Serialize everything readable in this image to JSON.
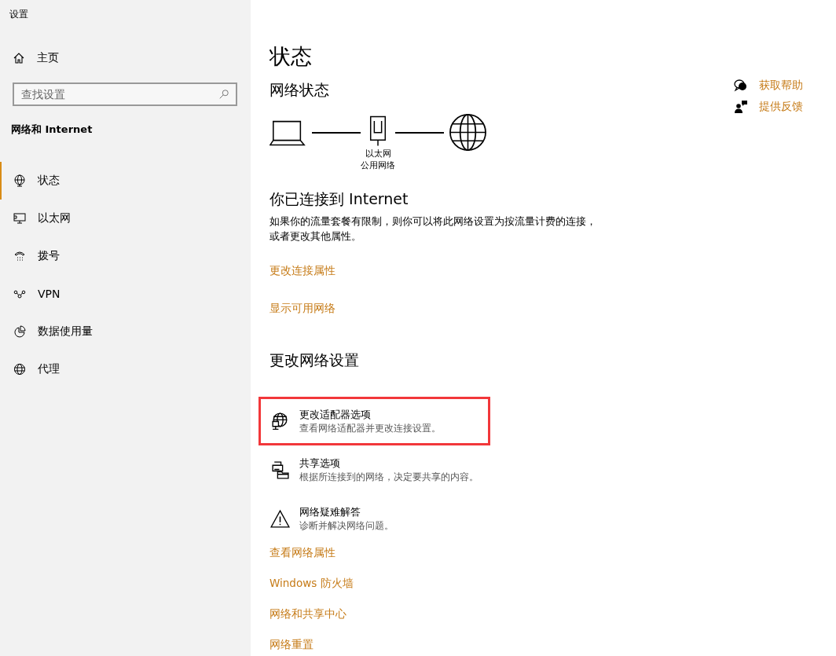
{
  "window": {
    "title": "设置"
  },
  "sidebar": {
    "home": "主页",
    "search": {
      "placeholder": "查找设置"
    },
    "section": "网络和 Internet",
    "items": [
      {
        "kind": "status",
        "label": "状态",
        "selected": true
      },
      {
        "kind": "ethernet",
        "label": "以太网",
        "selected": false
      },
      {
        "kind": "dialup",
        "label": "拨号",
        "selected": false
      },
      {
        "kind": "vpn",
        "label": "VPN",
        "selected": false
      },
      {
        "kind": "data",
        "label": "数据使用量",
        "selected": false
      },
      {
        "kind": "proxy",
        "label": "代理",
        "selected": false
      }
    ]
  },
  "page": {
    "title": "状态",
    "network_status": {
      "heading": "网络状态",
      "adapter_name": "以太网",
      "network_type": "公用网络"
    },
    "connection": {
      "heading": "你已连接到 Internet",
      "description": "如果你的流量套餐有限制，则你可以将此网络设置为按流量计费的连接，或者更改其他属性。"
    },
    "links": [
      "更改连接属性",
      "显示可用网络"
    ],
    "change_heading": "更改网络设置",
    "options": [
      {
        "kind": "adapter",
        "title": "更改适配器选项",
        "description": "查看网络适配器并更改连接设置。",
        "highlighted": true
      },
      {
        "kind": "sharing",
        "title": "共享选项",
        "description": "根据所连接到的网络，决定要共享的内容。",
        "highlighted": false
      },
      {
        "kind": "troubleshoot",
        "title": "网络疑难解答",
        "description": "诊断并解决网络问题。",
        "highlighted": false
      }
    ],
    "bottom_links": [
      "查看网络属性",
      "Windows 防火墙",
      "网络和共享中心",
      "网络重置"
    ]
  },
  "help": [
    {
      "kind": "help",
      "label": "获取帮助"
    },
    {
      "kind": "feedback",
      "label": "提供反馈"
    }
  ]
}
